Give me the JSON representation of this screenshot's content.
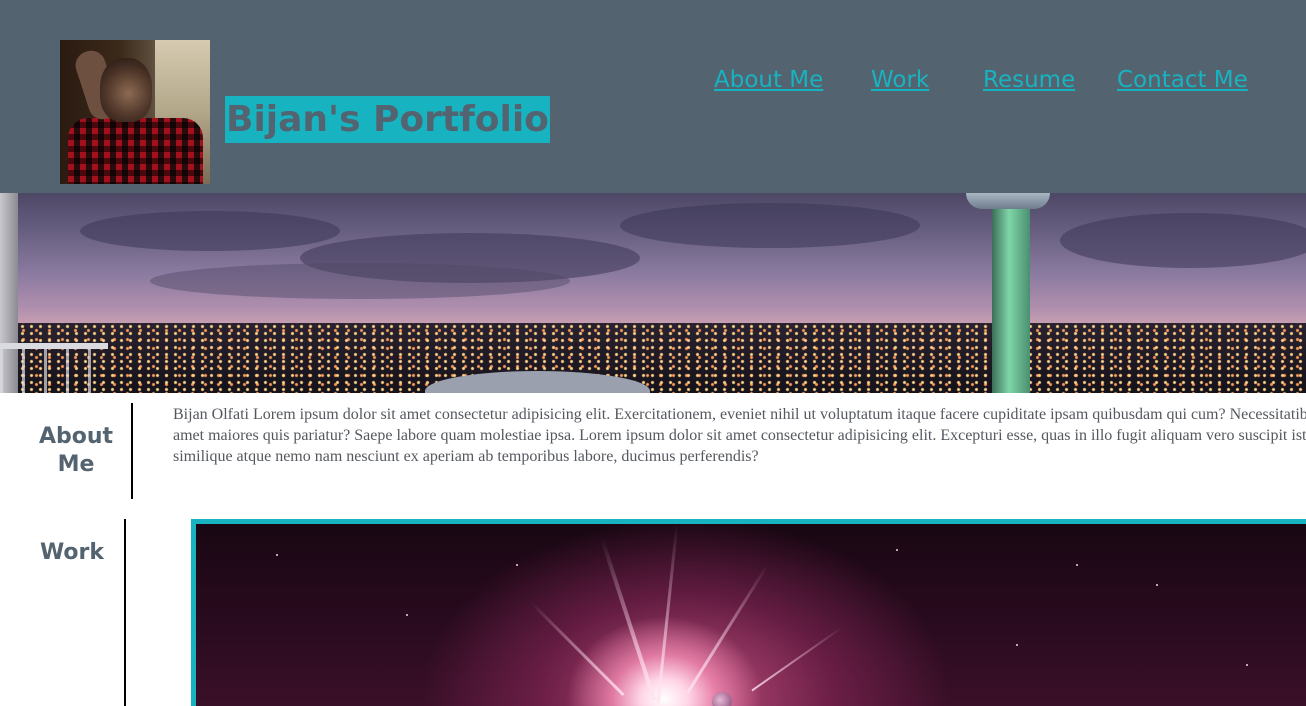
{
  "header": {
    "site_title": "Bijan's Portfolio",
    "nav": [
      {
        "label": "About Me"
      },
      {
        "label": "Work"
      },
      {
        "label": "Resume"
      },
      {
        "label": "Contact Me"
      }
    ]
  },
  "sections": {
    "about": {
      "heading": "About Me",
      "body": "Bijan Olfati Lorem ipsum dolor sit amet consectetur adipisicing elit. Exercitationem, eveniet nihil ut voluptatum itaque facere cupiditate ipsam quibusdam qui cum? Necessitatibus amet maiores quis pariatur? Saepe labore quam molestiae ipsa. Lorem ipsum dolor sit amet consectetur adipisicing elit. Excepturi esse, quas in illo fugit aliquam vero suscipit iste similique atque nemo nam nesciunt ex aperiam ab temporibus labore, ducimus perferendis?"
    },
    "work": {
      "heading": "Work"
    }
  },
  "colors": {
    "header_bg": "#546370",
    "accent": "#17b3c1",
    "heading_text": "#546370",
    "body_text": "#54585e"
  }
}
